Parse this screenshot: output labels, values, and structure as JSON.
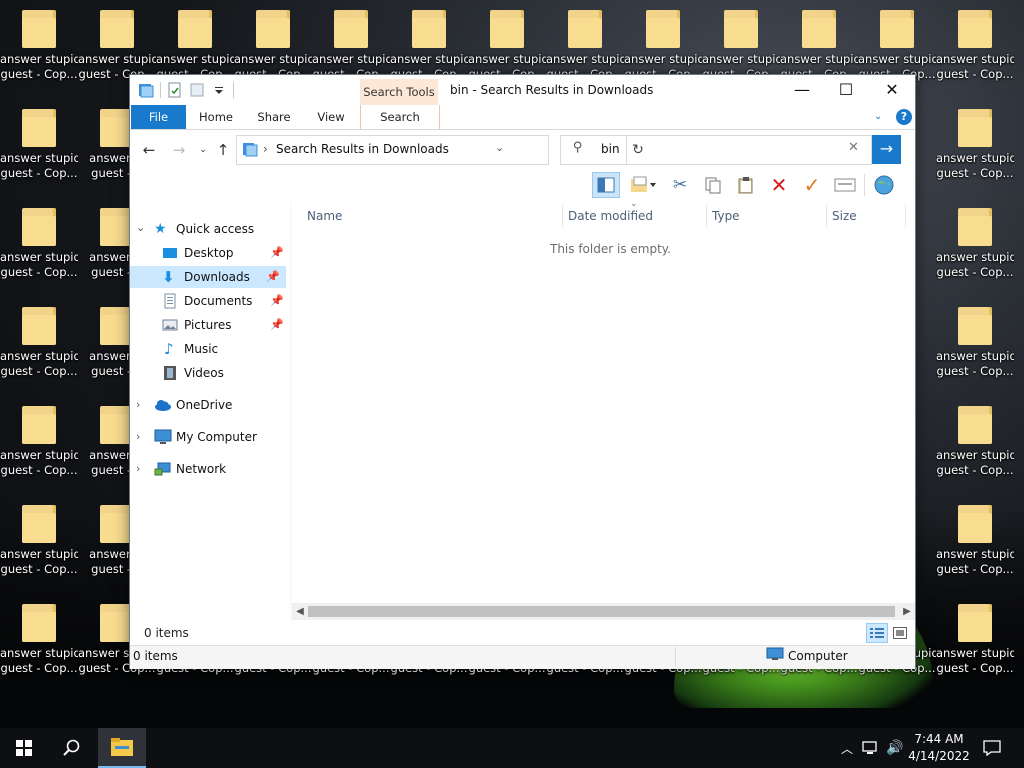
{
  "desktop": {
    "icon_label_line1": "answer stupid",
    "icon_label_line2": "guest - Cop...",
    "icon_label_line1_short": "answer st",
    "icon_label_line2_short": "guest - C",
    "icon_label_line1_tail": "pid",
    "icon_label_line2_tail": "Cop...",
    "top_left_label_line1": "answer stupid",
    "top_left_label_line2": "guest - Cop..."
  },
  "window": {
    "title": "bin - Search Results in Downloads",
    "contextual_tab_group": "Search Tools",
    "controls": {
      "minimize": "—",
      "maximize": "☐",
      "close": "✕"
    },
    "ribbon_tabs": {
      "file": "File",
      "home": "Home",
      "share": "Share",
      "view": "View",
      "search": "Search"
    },
    "help": "?",
    "address": {
      "path": "Search Results in Downloads",
      "separator": "›"
    },
    "search": {
      "value": "bin"
    },
    "navigation": {
      "quick_access": "Quick access",
      "desktop": "Desktop",
      "downloads": "Downloads",
      "documents": "Documents",
      "pictures": "Pictures",
      "music": "Music",
      "videos": "Videos",
      "onedrive": "OneDrive",
      "my_computer": "My Computer",
      "network": "Network"
    },
    "columns": {
      "name": "Name",
      "date_modified": "Date modified",
      "type": "Type",
      "size": "Size"
    },
    "empty_message": "This folder is empty.",
    "status": {
      "items": "0 items"
    },
    "bottom_bar": {
      "items": "0 items",
      "location": "Computer"
    },
    "accent": "#1979ca"
  },
  "taskbar": {
    "time": "7:44 AM",
    "date": "4/14/2022"
  }
}
